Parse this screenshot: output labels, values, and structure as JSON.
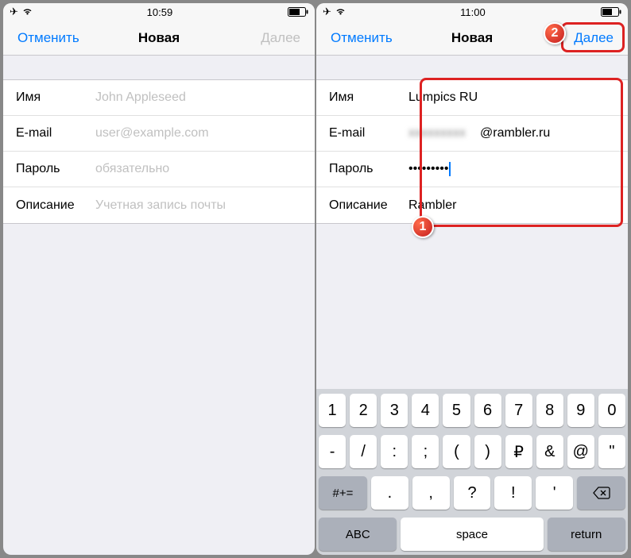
{
  "left": {
    "status": {
      "time": "10:59"
    },
    "nav": {
      "cancel": "Отменить",
      "title": "Новая",
      "next": "Далее"
    },
    "fields": {
      "name": {
        "label": "Имя",
        "placeholder": "John Appleseed"
      },
      "email": {
        "label": "E-mail",
        "placeholder": "user@example.com"
      },
      "password": {
        "label": "Пароль",
        "placeholder": "обязательно"
      },
      "description": {
        "label": "Описание",
        "placeholder": "Учетная запись почты"
      }
    }
  },
  "right": {
    "status": {
      "time": "11:00"
    },
    "nav": {
      "cancel": "Отменить",
      "title": "Новая",
      "next": "Далее"
    },
    "fields": {
      "name": {
        "label": "Имя",
        "value": "Lumpics RU"
      },
      "email": {
        "label": "E-mail",
        "value_suffix": "@rambler.ru"
      },
      "password": {
        "label": "Пароль",
        "value": "•••••••••"
      },
      "description": {
        "label": "Описание",
        "value": "Rambler"
      }
    }
  },
  "annotations": {
    "one": "1",
    "two": "2"
  },
  "keyboard": {
    "row1": [
      "1",
      "2",
      "3",
      "4",
      "5",
      "6",
      "7",
      "8",
      "9",
      "0"
    ],
    "row2": [
      "-",
      "/",
      ":",
      ";",
      "(",
      ")",
      "₽",
      "&",
      "@",
      "\""
    ],
    "row3_shift": "#+=",
    "row3": [
      ".",
      ",",
      "?",
      "!",
      "'"
    ],
    "abc": "ABC",
    "space": "space",
    "return": "return"
  }
}
